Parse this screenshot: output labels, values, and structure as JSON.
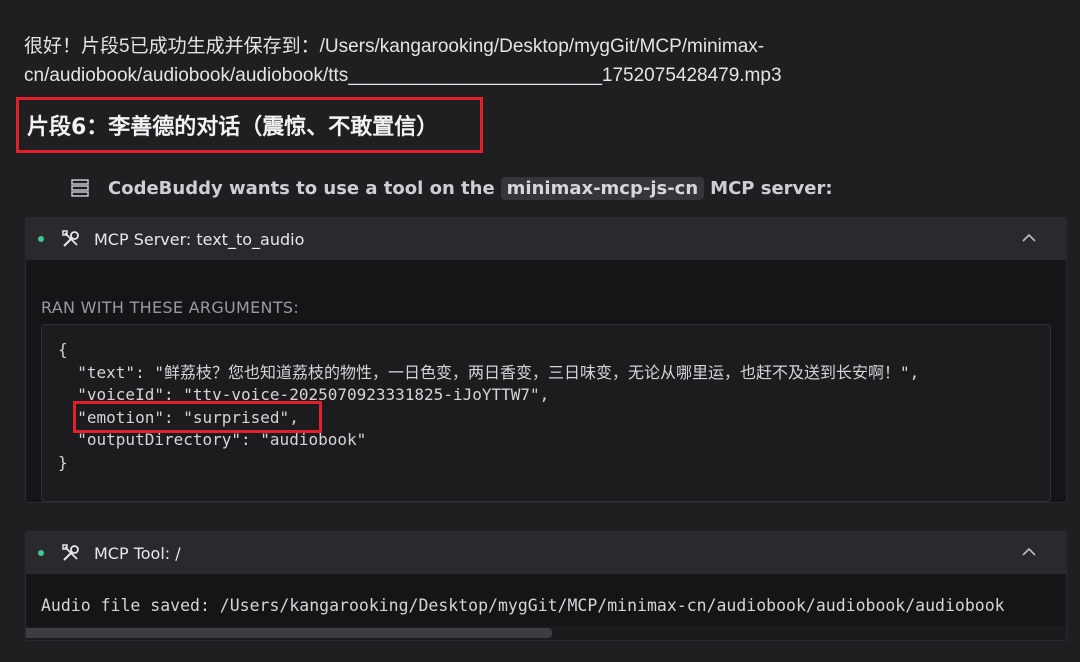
{
  "intro": {
    "line1": "很好！片段5已成功生成并保存到：/Users/kangarooking/Desktop/mygGit/MCP/minimax-",
    "line2": "cn/audiobook/audiobook/audiobook/tts________________________1752075428479.mp3"
  },
  "segment_heading": "片段6：李善德的对话（震惊、不敢置信）",
  "tool_request": {
    "prefix": "CodeBuddy wants to use a tool on the",
    "server": "minimax-mcp-js-cn",
    "suffix": "MCP server:"
  },
  "server_panel": {
    "title": "MCP Server: text_to_audio",
    "args_label": "RAN WITH THESE ARGUMENTS:",
    "code": {
      "open": "{",
      "line_text": "  \"text\": \"鲜荔枝？您也知道荔枝的物性，一日色变，两日香变，三日味变，无论从哪里运，也赶不及送到长安啊！\",",
      "line_voice": "  \"voiceId\": \"ttv-voice-2025070923331825-iJoYTTW7\",",
      "line_emotion": "  \"emotion\": \"surprised\",",
      "line_output": "  \"outputDirectory\": \"audiobook\"",
      "close": "}"
    }
  },
  "tool_panel": {
    "title": "MCP Tool: /",
    "output": "Audio file saved: /Users/kangarooking/Desktop/mygGit/MCP/minimax-cn/audiobook/audiobook/audiobook"
  },
  "colors": {
    "background": "#1f1f22",
    "highlight": "#e0202a",
    "status_dot": "#3ec98e"
  },
  "icons": [
    "server-icon",
    "tools-icon",
    "chevron-up-icon"
  ]
}
